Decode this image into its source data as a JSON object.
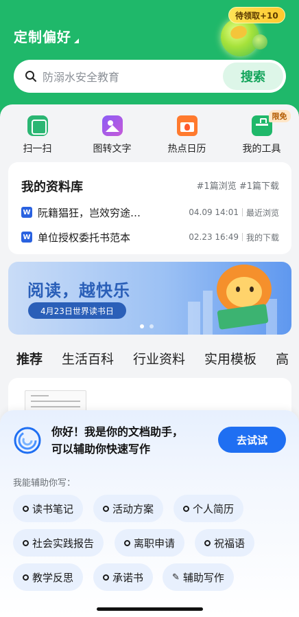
{
  "header": {
    "pref_label": "定制偏好",
    "reward_label": "待领取+10",
    "bg_color": "#1fb86a"
  },
  "search": {
    "placeholder": "防溺水安全教育",
    "button": "搜索"
  },
  "tools": [
    {
      "label": "扫一扫",
      "icon": "scan-icon"
    },
    {
      "label": "图转文字",
      "icon": "image-to-text-icon"
    },
    {
      "label": "热点日历",
      "icon": "hot-calendar-icon"
    },
    {
      "label": "我的工具",
      "icon": "toolbox-icon",
      "badge": "限免"
    }
  ],
  "library": {
    "title": "我的资料库",
    "stats": "#1篇浏览 #1篇下载",
    "items": [
      {
        "name": "阮籍猖狂，岂效穷途…",
        "date": "04.09  14:01",
        "action": "最近浏览"
      },
      {
        "name": "单位授权委托书范本",
        "date": "02.23  16:49",
        "action": "我的下载"
      }
    ]
  },
  "banner": {
    "slogan": "阅读，越快乐",
    "date_label": "4月23日世界读书日",
    "page_count": 2,
    "active_page": 1
  },
  "tabs": [
    "推荐",
    "生活百科",
    "行业资料",
    "实用模板",
    "高"
  ],
  "assistant": {
    "greeting_line1": "你好！我是你的文档助手，",
    "greeting_line2": "可以辅助你快速写作",
    "try_button": "去试试",
    "subtitle": "我能辅助你写：",
    "chips": [
      {
        "label": "读书笔记",
        "icon": "circle"
      },
      {
        "label": "活动方案",
        "icon": "circle"
      },
      {
        "label": "个人简历",
        "icon": "circle"
      },
      {
        "label": "社会实践报告",
        "icon": "circle"
      },
      {
        "label": "离职申请",
        "icon": "circle"
      },
      {
        "label": "祝福语",
        "icon": "circle"
      },
      {
        "label": "教学反思",
        "icon": "circle"
      },
      {
        "label": "承诺书",
        "icon": "circle"
      },
      {
        "label": "辅助写作",
        "icon": "pen"
      }
    ]
  }
}
